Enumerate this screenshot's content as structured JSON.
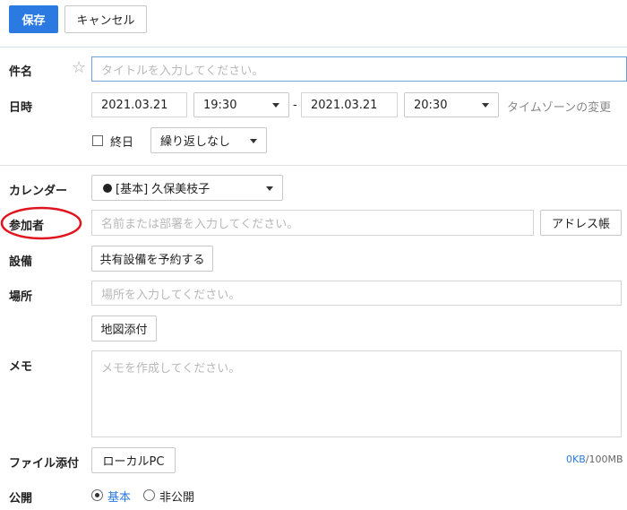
{
  "toolbar": {
    "save_label": "保存",
    "cancel_label": "キャンセル"
  },
  "subject": {
    "label": "件名",
    "placeholder": "タイトルを入力してください。"
  },
  "datetime": {
    "label": "日時",
    "start_date": "2021.03.21",
    "start_time": "19:30",
    "separator": "-",
    "end_date": "2021.03.21",
    "end_time": "20:30",
    "timezone_link": "タイムゾーンの変更",
    "all_day_label": "終日",
    "repeat_value": "繰り返しなし"
  },
  "calendar": {
    "label": "カレンダー",
    "value": "[基本] 久保美枝子",
    "dot_color": "#222222"
  },
  "attendees": {
    "label": "参加者",
    "placeholder": "名前または部署を入力してください。",
    "address_book_label": "アドレス帳",
    "highlight_color": "#e0141e"
  },
  "equipment": {
    "label": "設備",
    "reserve_button": "共有設備を予約する"
  },
  "location": {
    "label": "場所",
    "placeholder": "場所を入力してください。",
    "map_button": "地図添付"
  },
  "memo": {
    "label": "メモ",
    "placeholder": "メモを作成してください。"
  },
  "attachment": {
    "label": "ファイル添付",
    "local_pc_button": "ローカルPC",
    "used": "0KB",
    "limit": "/100MB",
    "used_color": "#2a7ae2"
  },
  "visibility": {
    "label": "公開",
    "option_basic": "基本",
    "option_private": "非公開",
    "basic_color": "#2a7ae2",
    "selected": "基本"
  },
  "icons": {
    "star": "star-icon",
    "caret": "chevron-down-icon",
    "calendar_dot": "calendar-color-dot-icon"
  }
}
